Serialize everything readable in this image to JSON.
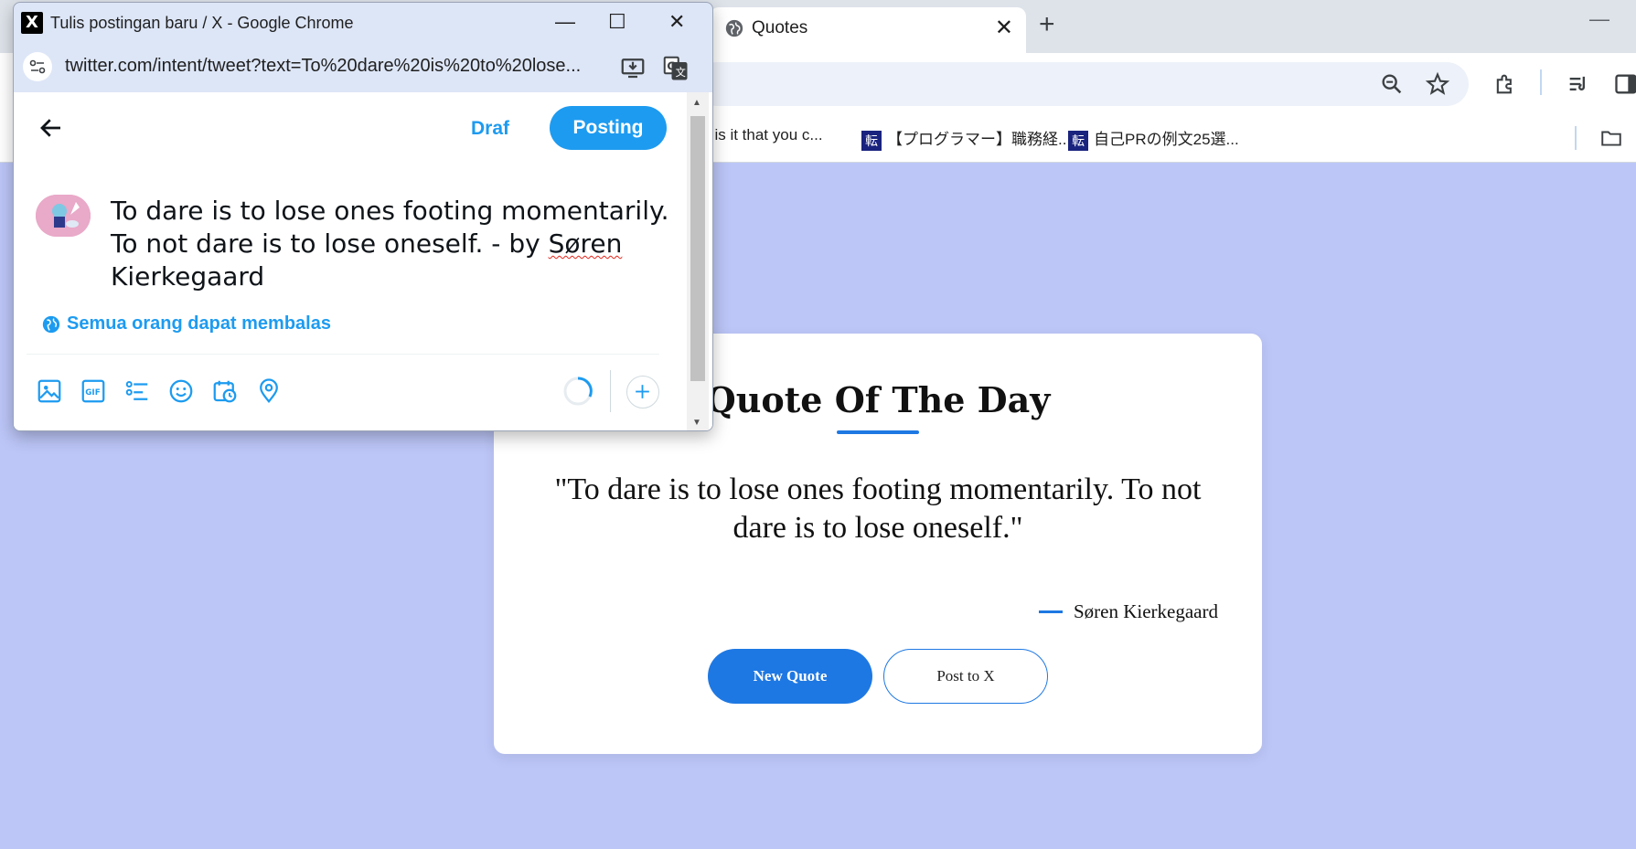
{
  "browser": {
    "tab_title": "Quotes",
    "tab_close": "✕",
    "new_tab": "+",
    "minimize": "—",
    "bookmarks": [
      {
        "label": "t is it that you c..."
      },
      {
        "label": "【プログラマー】職務経...",
        "favicon": "転"
      },
      {
        "label": "自己PRの例文25選...",
        "favicon": "転"
      }
    ]
  },
  "quote_card": {
    "title": "Quote Of The Day",
    "quote": "\"To dare is to lose ones footing momentarily. To not dare is to lose oneself.\"",
    "author": "Søren Kierkegaard",
    "new_quote_label": "New Quote",
    "post_label": "Post to X"
  },
  "popup": {
    "logo": "X",
    "window_title": "Tulis postingan baru / X - Google Chrome",
    "minimize": "—",
    "maximize": "☐",
    "close": "✕",
    "url": "twitter.com/intent/tweet?text=To%20dare%20is%20to%20lose...",
    "draft_label": "Draf",
    "post_label": "Posting",
    "tweet_text_main": "To dare is to lose ones footing momentarily. To not dare is to lose oneself. - by ",
    "tweet_text_flagged": "Søren",
    "tweet_text_tail": " Kierkegaard",
    "reply_setting": "Semua orang dapat membalas",
    "gif_label": "GIF"
  },
  "colors": {
    "page_background": "#bcc6f7",
    "accent_blue": "#1e78e3",
    "twitter_blue": "#1d9bf0"
  }
}
